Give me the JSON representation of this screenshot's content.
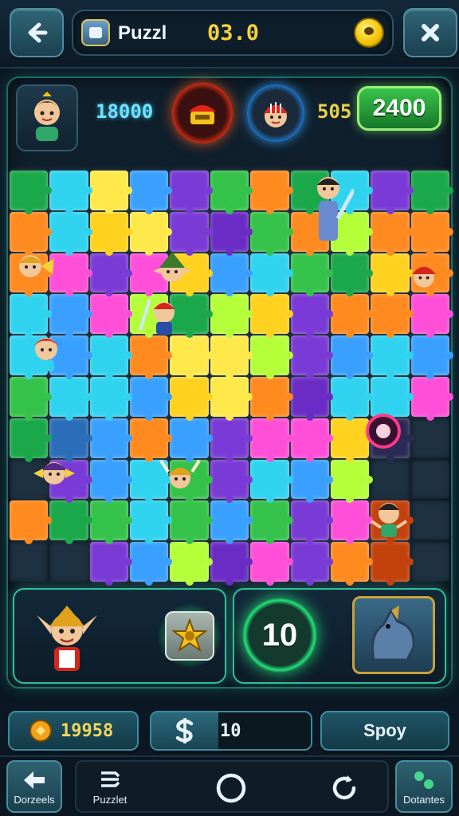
{
  "header": {
    "back_icon": "arrow-left-icon",
    "app_title": "Puzzl",
    "coins": "03.0",
    "close_icon": "close-x-icon"
  },
  "hud": {
    "score_label": "18000",
    "level_label": "505",
    "target_score": "2400"
  },
  "board": {
    "columns": 11,
    "rows": 10,
    "tile_colors": [
      [
        "#1aa84a",
        "#2fd3f0",
        "#ffe94a",
        "#3aa0ff",
        "#7a3ad6",
        "#34c24a",
        "#ff8a1f",
        "#1aa84a",
        "#2fd3f0",
        "#7a3ad6",
        "#1aa84a"
      ],
      [
        "#ff8a1f",
        "#2fd3f0",
        "#ffd21f",
        "#ffe94a",
        "#7a3ad6",
        "#6a2cc4",
        "#34c24a",
        "#ff8a1f",
        "#b4ff3a",
        "#ff8a1f",
        "#ff8a1f"
      ],
      [
        "#ff8a1f",
        "#ff4fd8",
        "#7a3ad6",
        "#ff4fd8",
        "#ffd21f",
        "#3aa0ff",
        "#2fd3f0",
        "#34c24a",
        "#1aa84a",
        "#ffd21f",
        "#ff8a1f"
      ],
      [
        "#2fd3f0",
        "#3aa0ff",
        "#ff4fd8",
        "#b4ff3a",
        "#1aa84a",
        "#b4ff3a",
        "#ffd21f",
        "#7a3ad6",
        "#ff8a1f",
        "#ff8a1f",
        "#ff4fd8"
      ],
      [
        "#2fd3f0",
        "#3aa0ff",
        "#2fd3f0",
        "#ff8a1f",
        "#ffe94a",
        "#ffe94a",
        "#b4ff3a",
        "#7a3ad6",
        "#3aa0ff",
        "#2fd3f0",
        "#3aa0ff"
      ],
      [
        "#34c24a",
        "#2fd3f0",
        "#2fd3f0",
        "#3aa0ff",
        "#ffd21f",
        "#ffe94a",
        "#ff8a1f",
        "#6a2cc4",
        "#2fd3f0",
        "#2fd3f0",
        "#ff4fd8"
      ],
      [
        "#1aa84a",
        "#2a6db8",
        "#3aa0ff",
        "#ff8a1f",
        "#3aa0ff",
        "#7a3ad6",
        "#ff4fd8",
        "#ff4fd8",
        "#ffd21f",
        "#2a2a55",
        "#1e3140"
      ],
      [
        "#1e3140",
        "#7a3ad6",
        "#3aa0ff",
        "#2fd3f0",
        "#34c24a",
        "#7a3ad6",
        "#2fd3f0",
        "#3aa0ff",
        "#b4ff3a",
        "#1e3140",
        "#1e3140"
      ],
      [
        "#ff8a1f",
        "#1aa84a",
        "#34c24a",
        "#2fd3f0",
        "#34c24a",
        "#3aa0ff",
        "#34c24a",
        "#7a3ad6",
        "#ff4fd8",
        "#c2410c",
        "#1e3140"
      ],
      [
        "#1e3140",
        "#1e3140",
        "#7a3ad6",
        "#3aa0ff",
        "#b4ff3a",
        "#6a2cc4",
        "#ff4fd8",
        "#7a3ad6",
        "#ff8a1f",
        "#c2410c",
        "#1e3140"
      ]
    ]
  },
  "panels": {
    "left_bonus_icon": "star-badge-icon",
    "moves_left": "10",
    "right_card_icon": "horse-mount-icon"
  },
  "stats": {
    "gems": "19958",
    "cash_icon": "dollar-icon",
    "cash": "10",
    "spin_label": "Spoy"
  },
  "nav": {
    "left_label": "Dorzeels",
    "puzzle_label": "Puzzlet",
    "right_label": "Dotantes"
  },
  "colors": {
    "background": "#0b1722",
    "accent_teal": "#2fbf9a",
    "score_green": "#39c24a",
    "coin_gold": "#f4d23a"
  }
}
